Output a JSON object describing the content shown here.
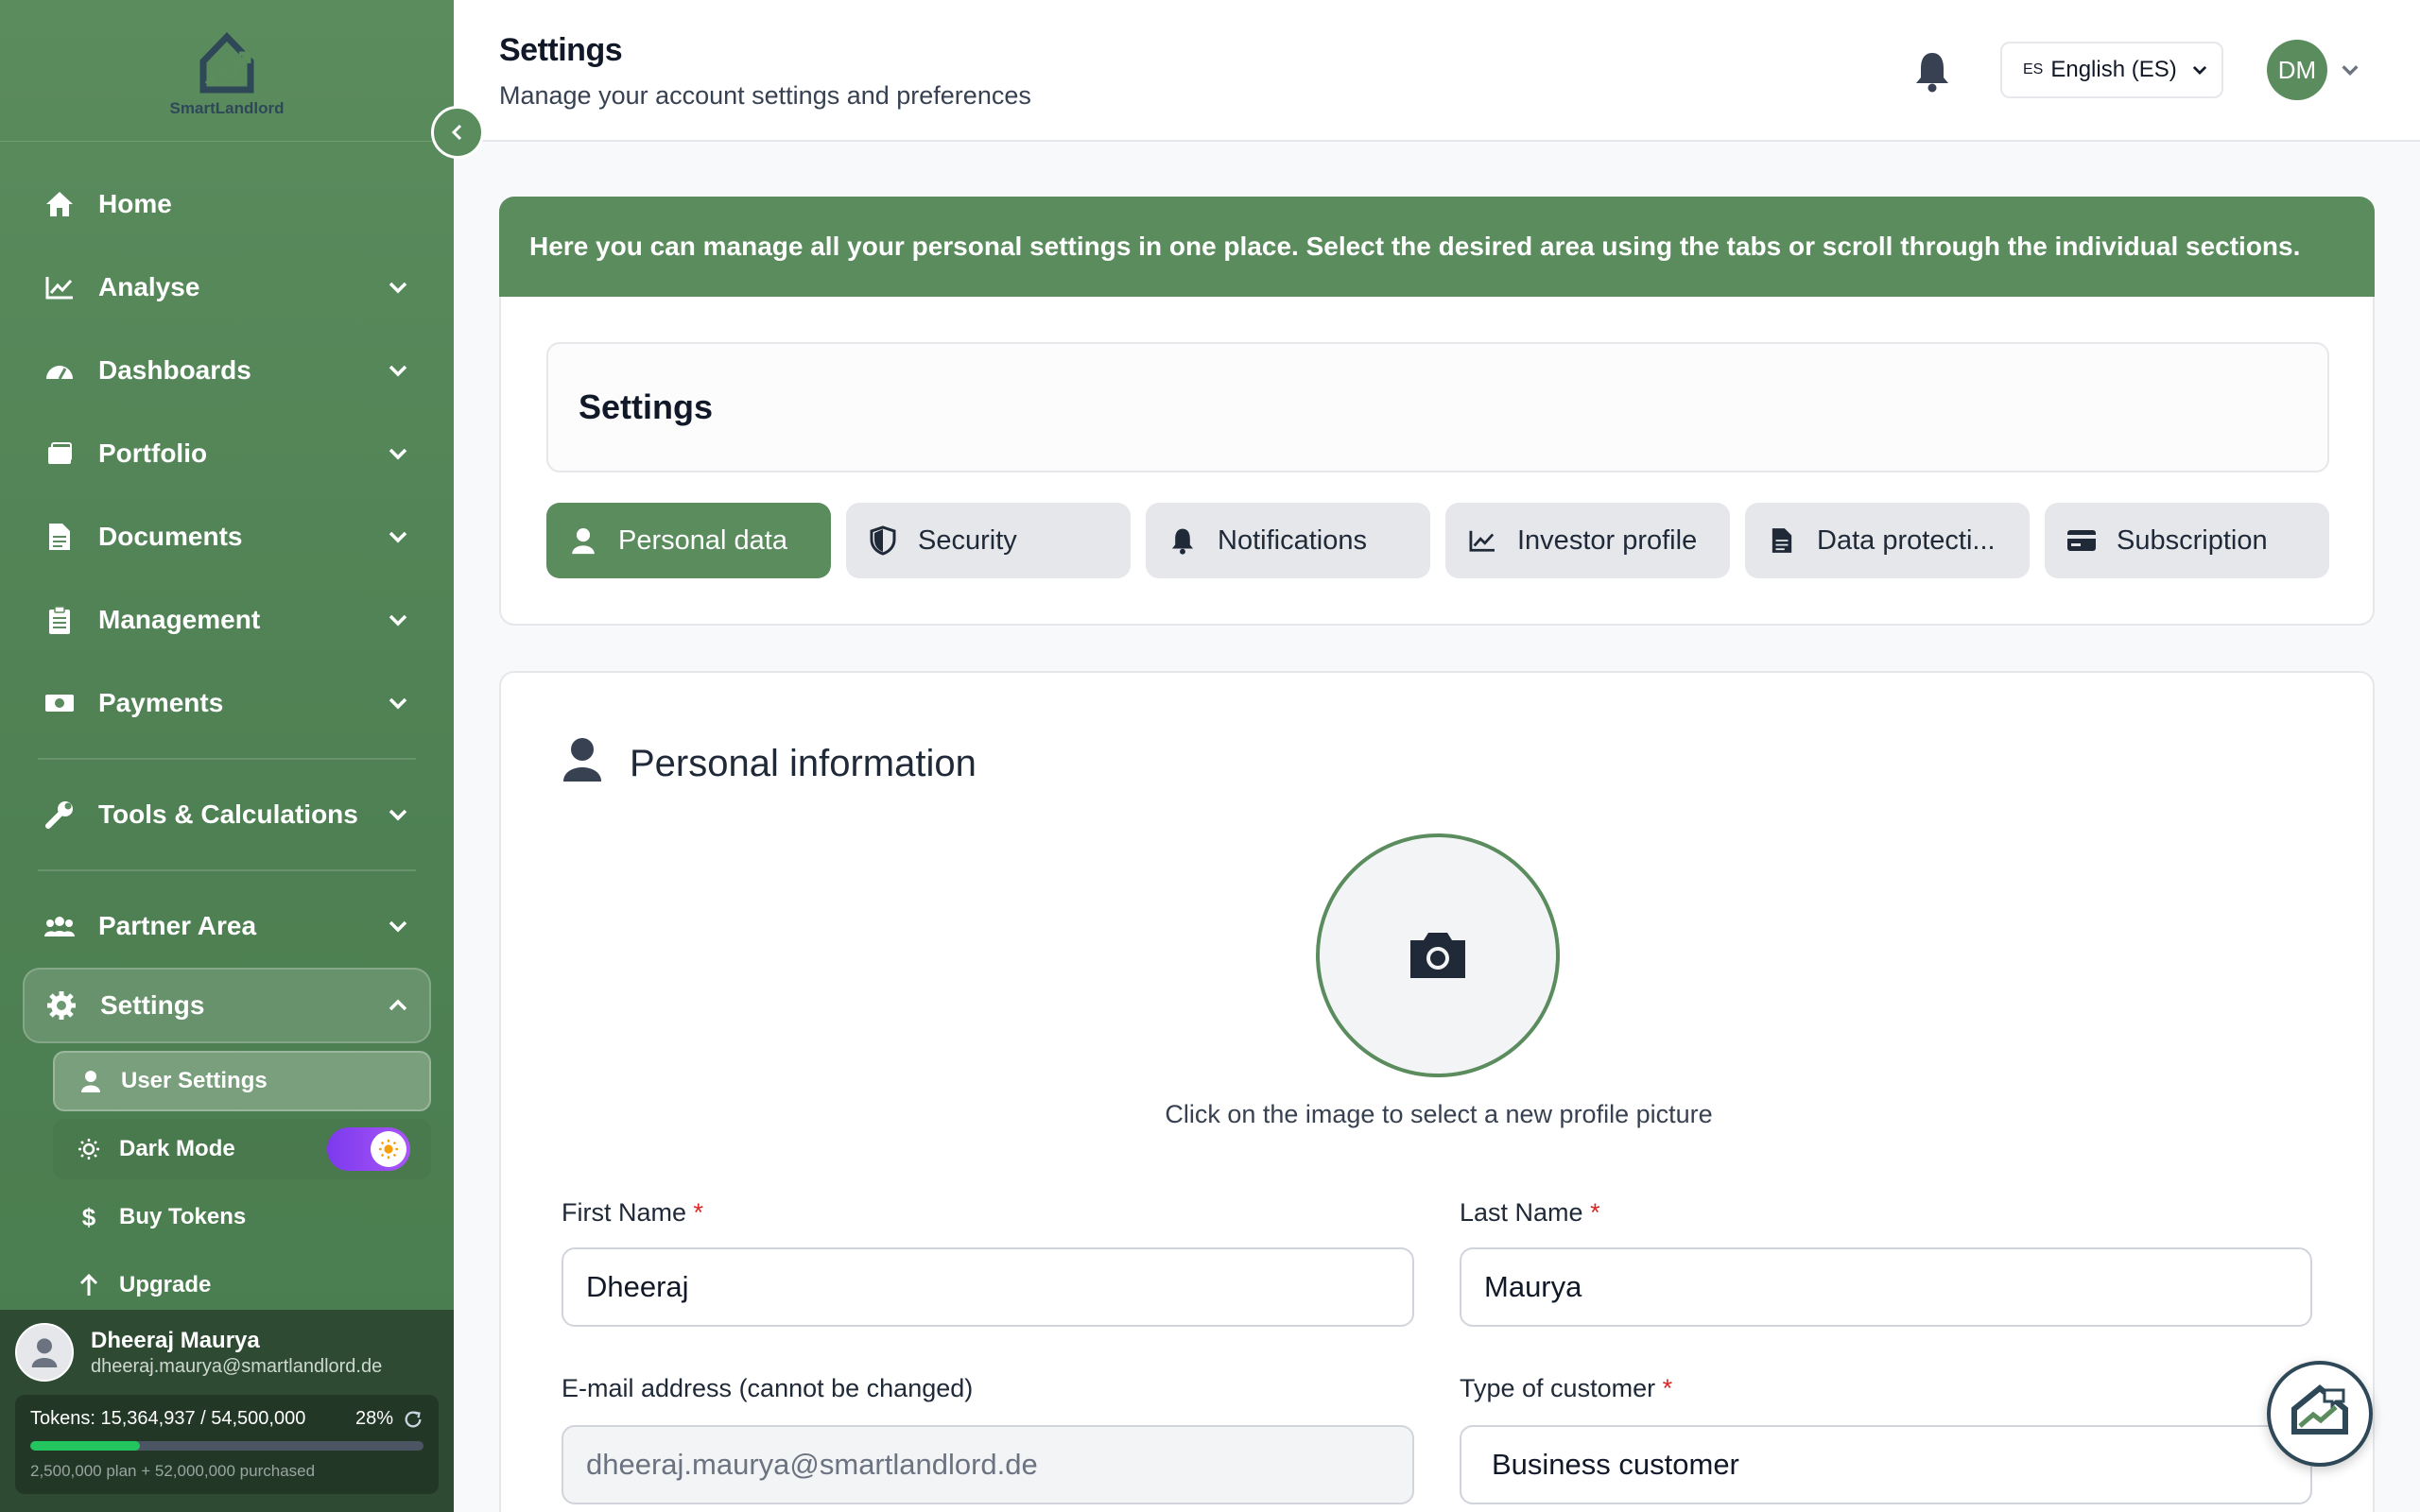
{
  "brand": {
    "name": "SmartLandlord"
  },
  "sidebar": {
    "items": [
      {
        "label": "Home",
        "icon": "home-icon"
      },
      {
        "label": "Analyse",
        "icon": "chart-line-icon"
      },
      {
        "label": "Dashboards",
        "icon": "gauge-icon"
      },
      {
        "label": "Portfolio",
        "icon": "folder-icon"
      },
      {
        "label": "Documents",
        "icon": "document-icon"
      },
      {
        "label": "Management",
        "icon": "clipboard-icon"
      },
      {
        "label": "Payments",
        "icon": "money-icon"
      },
      {
        "label": "Tools & Calculations",
        "icon": "wrench-icon"
      },
      {
        "label": "Partner Area",
        "icon": "users-icon"
      },
      {
        "label": "Settings",
        "icon": "gear-icon"
      }
    ],
    "settings_sub": {
      "user_settings": "User Settings",
      "dark_mode": "Dark Mode",
      "buy_tokens": "Buy Tokens",
      "upgrade": "Upgrade"
    }
  },
  "user": {
    "name": "Dheeraj Maurya",
    "email": "dheeraj.maurya@smartlandlord.de",
    "tokens_text": "Tokens: 15,364,937 / 54,500,000",
    "tokens_pct": "28%",
    "tokens_fraction": 0.28,
    "tokens_sub": "2,500,000 plan + 52,000,000 purchased"
  },
  "header": {
    "title": "Settings",
    "subtitle": "Manage your account settings and preferences",
    "lang_code": "ES",
    "lang_label": "English (ES)",
    "avatar_initials": "DM"
  },
  "banner": "Here you can manage all your personal settings in one place. Select the desired area using the tabs or scroll through the individual sections.",
  "settings_card": {
    "title": "Settings",
    "tabs": [
      {
        "label": "Personal data",
        "icon": "user-icon"
      },
      {
        "label": "Security",
        "icon": "shield-icon"
      },
      {
        "label": "Notifications",
        "icon": "bell-icon"
      },
      {
        "label": "Investor profile",
        "icon": "chart-line-icon"
      },
      {
        "label": "Data protecti...",
        "icon": "document-icon"
      },
      {
        "label": "Subscription",
        "icon": "credit-card-icon"
      }
    ]
  },
  "personal": {
    "title": "Personal information",
    "photo_hint": "Click on the image to select a new profile picture",
    "first_name_label": "First Name",
    "first_name_value": "Dheeraj",
    "last_name_label": "Last Name",
    "last_name_value": "Maurya",
    "email_label": "E-mail address (cannot be changed)",
    "email_value": "dheeraj.maurya@smartlandlord.de",
    "customer_type_label": "Type of customer",
    "customer_type_value": "Business customer",
    "required_mark": "*"
  },
  "colors": {
    "brand_green": "#5b8c5e",
    "dark_green": "#2e4a33",
    "required": "#dc2626"
  }
}
